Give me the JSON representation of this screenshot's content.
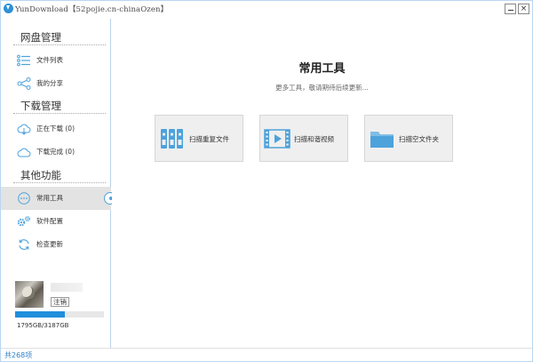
{
  "window": {
    "title": "YunDownload【52pojie.cn-chinaOzen】",
    "minimize_label": "",
    "close_label": "×"
  },
  "sidebar": {
    "sections": [
      {
        "title": "网盘管理"
      },
      {
        "title": "下载管理"
      },
      {
        "title": "其他功能"
      }
    ],
    "items": [
      {
        "label": "文件列表",
        "icon": "list-icon"
      },
      {
        "label": "我的分享",
        "icon": "share-icon"
      },
      {
        "label": "正在下载  (0)",
        "icon": "cloud-download-icon"
      },
      {
        "label": "下载完成  (0)",
        "icon": "cloud-done-icon"
      },
      {
        "label": "常用工具",
        "icon": "tools-icon",
        "active": true
      },
      {
        "label": "软件配置",
        "icon": "gears-icon"
      },
      {
        "label": "检查更新",
        "icon": "refresh-icon"
      }
    ],
    "user": {
      "logout_label": "注销",
      "storage_text": "1795GB/3187GB",
      "storage_used_fraction": 0.563
    }
  },
  "main": {
    "title": "常用工具",
    "subtitle": "更多工具，敬请期待后续更新...",
    "tools": [
      {
        "label": "扫描重复文件",
        "icon": "duplicate-files-icon"
      },
      {
        "label": "扫描和谐视频",
        "icon": "video-film-icon"
      },
      {
        "label": "扫描空文件夹",
        "icon": "folder-icon"
      }
    ]
  },
  "status": {
    "text": "共268项"
  },
  "colors": {
    "accent": "#1f8fdc",
    "icon_blue": "#4da2dc",
    "border": "#b8d3ea"
  }
}
